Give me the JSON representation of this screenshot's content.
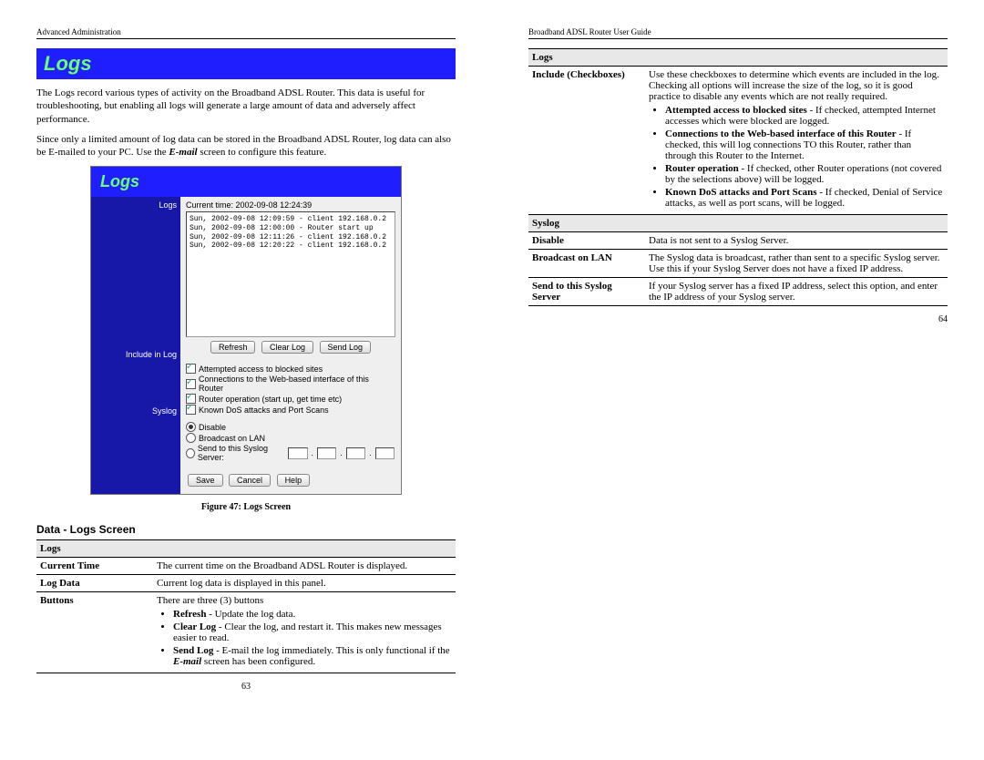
{
  "left": {
    "header": "Advanced Administration",
    "title": "Logs",
    "para1": "The Logs record various types of activity on the Broadband ADSL Router. This data is useful for troubleshooting, but enabling all logs will generate a large amount of data and adversely affect performance.",
    "para2_a": "Since only a limited amount of log data can be stored in the Broadband ADSL Router, log data can also be E-mailed to your PC. Use the ",
    "para2_em": "E-mail",
    "para2_b": " screen to configure this feature.",
    "shot": {
      "title": "Logs",
      "sidebar": {
        "logs": "Logs",
        "include": "Include in Log",
        "syslog": "Syslog"
      },
      "current_time_label": "Current time:",
      "current_time_value": "2002-09-08 12:24:39",
      "log_lines": "Sun, 2002-09-08 12:09:59 - client 192.168.0.2\nSun, 2002-09-08 12:00:00 - Router start up\nSun, 2002-09-08 12:11:26 - client 192.168.0.2\nSun, 2002-09-08 12:20:22 - client 192.168.0.2",
      "buttons": {
        "refresh": "Refresh",
        "clear": "Clear Log",
        "send": "Send Log"
      },
      "checks": {
        "c1": "Attempted access to blocked sites",
        "c2": "Connections to the Web-based interface of this Router",
        "c3": "Router operation (start up, get time etc)",
        "c4": "Known DoS attacks and Port Scans"
      },
      "radios": {
        "r1": "Disable",
        "r2": "Broadcast on LAN",
        "r3": "Send to this Syslog Server:"
      },
      "bottom": {
        "save": "Save",
        "cancel": "Cancel",
        "help": "Help"
      }
    },
    "caption": "Figure 47: Logs Screen",
    "section": "Data - Logs Screen",
    "table": {
      "group": "Logs",
      "rows": [
        {
          "k": "Current Time",
          "v": "The current time on the Broadband ADSL Router is displayed."
        },
        {
          "k": "Log Data",
          "v": "Current log data is displayed in this panel."
        }
      ],
      "buttons_k": "Buttons",
      "buttons_intro": "There are three (3) buttons",
      "bullets": {
        "b1_a": "Refresh",
        "b1_b": " - Update the log data.",
        "b2_a": "Clear Log",
        "b2_b": " - Clear the log, and restart it. This makes new messages easier to read.",
        "b3_a": "Send Log",
        "b3_b": " - E-mail the log immediately. This is only functional if the ",
        "b3_em": "E-mail",
        "b3_c": " screen has been configured."
      }
    },
    "pagenum": "63"
  },
  "right": {
    "header": "Broadband ADSL Router User Guide",
    "table1": {
      "group": "Logs",
      "include_k": "Include (Checkboxes)",
      "include_intro": "Use these checkboxes to determine which events are included in the log. Checking all options will increase the size of the log, so it is good practice to disable any events which are not really required.",
      "bullets": {
        "b1_a": "Attempted access to blocked sites",
        "b1_b": " - If checked, attempted Internet accesses which were blocked are logged.",
        "b2_a": "Connections to the Web-based interface of this Router",
        "b2_b": " - If checked, this will log connections TO this Router, rather than through this Router to the Internet.",
        "b3_a": "Router operation",
        "b3_b": " - If checked, other Router operations (not covered by the selections above) will be logged.",
        "b4_a": "Known DoS attacks and Port Scans",
        "b4_b": " - If checked, Denial of Service attacks, as well as port scans, will be logged."
      }
    },
    "table2": {
      "group": "Syslog",
      "rows": {
        "disable_k": "Disable",
        "disable_v": "Data is not sent to a Syslog Server.",
        "bcast_k": "Broadcast on LAN",
        "bcast_v": "The Syslog data is broadcast, rather than sent to a specific Syslog server. Use this if your Syslog Server does not have a fixed IP address.",
        "send_k": "Send to this Syslog Server",
        "send_v": "If your Syslog server has a fixed IP address, select this option, and enter the IP address of your Syslog server."
      }
    },
    "pagenum": "64"
  }
}
